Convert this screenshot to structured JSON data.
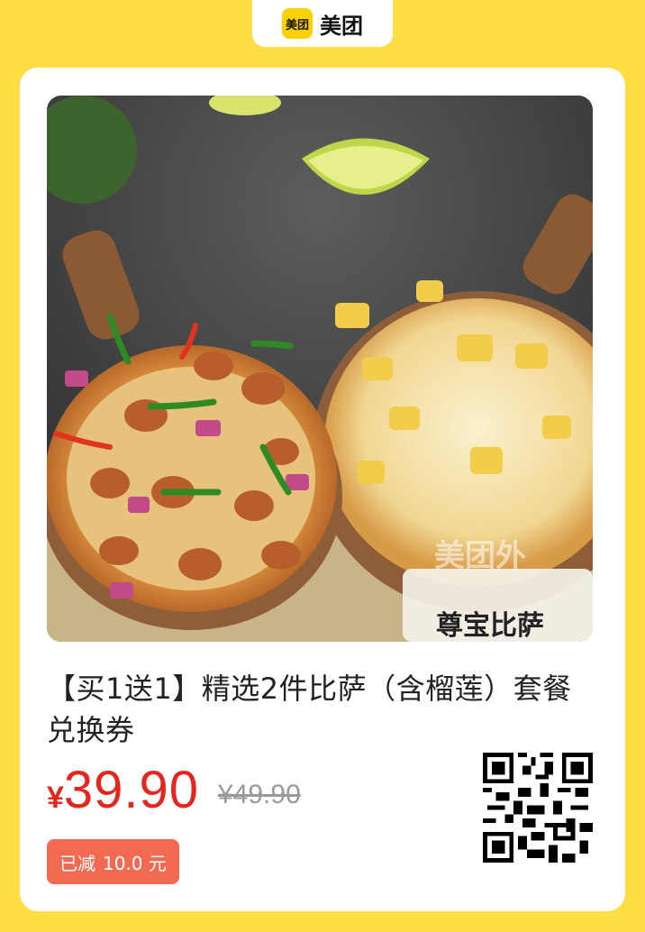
{
  "brand": {
    "logo_text": "美团",
    "name": "美团"
  },
  "product": {
    "title": "【买1送1】精选2件比萨（含榴莲）套餐兑换券",
    "image_overlay": {
      "label_text": "尊宝比萨",
      "watermark_text": "美团外"
    }
  },
  "pricing": {
    "currency": "¥",
    "current_price": "39.90",
    "original_price": "¥49.90",
    "discount_prefix": "已减",
    "discount_value": "10.0 元"
  },
  "colors": {
    "background": "#FFDD44",
    "price": "#E6251E",
    "discount_badge": "#F36A53"
  },
  "icons": [
    "meituan-logo-icon",
    "qr-code-icon"
  ]
}
